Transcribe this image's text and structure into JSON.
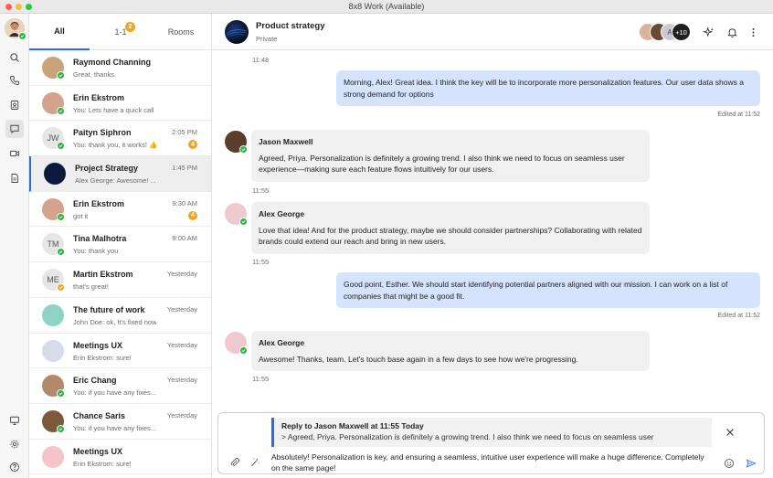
{
  "window": {
    "title": "8x8 Work (Available)"
  },
  "tabs": {
    "all": "All",
    "one_to_one": "1-1",
    "one_to_one_badge": "2",
    "rooms": "Rooms"
  },
  "conversations": [
    {
      "name": "Raymond Channing",
      "preview": "Great, thanks.",
      "time": "",
      "unread": "",
      "initials": "",
      "avatar_color": "#c9a37a",
      "presence": "available"
    },
    {
      "name": "Erin Ekstrom",
      "preview": "You: Lets have a quick call",
      "time": "",
      "unread": "",
      "initials": "",
      "avatar_color": "#d4a38c",
      "presence": "available"
    },
    {
      "name": "Paityn Siphron",
      "preview": "You: thank you, it works! 👍",
      "time": "2:05 PM",
      "unread": "4",
      "initials": "JW",
      "avatar_color": "#e6e6e6",
      "presence": "available"
    },
    {
      "name": "Project Strategy",
      "preview": "Alex George:  Awesome! ...",
      "time": "1:45 PM",
      "unread": "",
      "initials": "",
      "avatar_color": "#0b1a3a",
      "presence": ""
    },
    {
      "name": "Erin Ekstrom",
      "preview": "got it",
      "time": "9:30 AM",
      "unread": "4",
      "initials": "",
      "avatar_color": "#d4a38c",
      "presence": "available"
    },
    {
      "name": "Tina Malhotra",
      "preview": "You: thank you",
      "time": "9:00 AM",
      "unread": "",
      "initials": "TM",
      "avatar_color": "#e6e6e6",
      "presence": "available"
    },
    {
      "name": "Martin Ekstrom",
      "preview": "that's great!",
      "time": "Yesterday",
      "unread": "",
      "initials": "ME",
      "avatar_color": "#e6e6e6",
      "presence": "away"
    },
    {
      "name": "The future of work",
      "preview": "John Doe: ok, It's fixed now",
      "time": "Yesterday",
      "unread": "",
      "initials": "",
      "avatar_color": "#8fd3c7",
      "presence": ""
    },
    {
      "name": "Meetings UX",
      "preview": "Erin Ekstrom: sure!",
      "time": "Yesterday",
      "unread": "",
      "initials": "",
      "avatar_color": "#d7dcea",
      "presence": ""
    },
    {
      "name": "Eric Chang",
      "preview": "You: if you have any fixes...",
      "time": "Yesterday",
      "unread": "",
      "initials": "",
      "avatar_color": "#b08a6a",
      "presence": "available"
    },
    {
      "name": "Chance Saris",
      "preview": "You: if you have any fixes...",
      "time": "Yesterday",
      "unread": "",
      "initials": "",
      "avatar_color": "#7a5a3a",
      "presence": "available"
    },
    {
      "name": "Meetings UX",
      "preview": "Erin Ekstrom: sure!",
      "time": "",
      "unread": "",
      "initials": "",
      "avatar_color": "#f5c4c9",
      "presence": ""
    }
  ],
  "chat": {
    "room_name": "Product strategy",
    "room_visibility": "Private",
    "member_overflow": "+10",
    "member_initial": "A",
    "messages": [
      {
        "type": "timestamp",
        "text": "11:48"
      },
      {
        "type": "out",
        "text": "Morning, Alex! Great idea. I think the key will be to incorporate more personalization features. Our user data shows a strong demand for options",
        "edited": "Edited at 11:52"
      },
      {
        "type": "in",
        "sender": "Jason Maxwell",
        "text": "Agreed, Priya. Personalization is definitely a growing trend. I also think we need to focus on seamless user experience—making sure each feature flows intuitively for our users."
      },
      {
        "type": "timestamp",
        "text": "11:55"
      },
      {
        "type": "in",
        "sender": "Alex George",
        "text": "Love that idea! And for the product strategy, maybe we should consider partnerships? Collaborating with related brands could extend our reach and bring in new users."
      },
      {
        "type": "timestamp",
        "text": "11:55"
      },
      {
        "type": "out",
        "text": "Good point, Esther. We should start identifying potential partners aligned with our mission. I can work on a list of companies that might be a good fit.",
        "edited": "Edited at 11:52"
      },
      {
        "type": "in",
        "sender": "Alex George",
        "text": "Awesome! Thanks, team. Let's touch base again in a few days to see how we're progressing."
      },
      {
        "type": "timestamp",
        "text": "11:55"
      }
    ]
  },
  "composer": {
    "reply_title": "Reply to Jason Maxwell at 11:55 Today",
    "reply_quote": "> Agreed, Priya. Personalization is definitely a growing trend. I also think we need to focus on seamless user",
    "draft": "Absolutely! Personalization is key, and ensuring a seamless, intuitive user experience will make a huge difference. Completely on the same page!"
  },
  "icons": {
    "rail": [
      "search-icon",
      "phone-icon",
      "contacts-icon",
      "chat-icon",
      "video-icon",
      "document-icon",
      "monitor-icon",
      "gear-icon",
      "help-icon"
    ],
    "header": [
      "sparkle-icon",
      "bell-icon",
      "more-vertical-icon"
    ],
    "composer": [
      "attachment-icon",
      "magic-wand-icon",
      "emoji-icon",
      "send-icon",
      "close-icon"
    ]
  },
  "colors": {
    "accent": "#2d6cdf",
    "outgoing_bubble": "#d5e4fc",
    "incoming_bubble": "#f0f0f0",
    "unread_badge": "#f0a526",
    "presence_available": "#2fb344"
  }
}
